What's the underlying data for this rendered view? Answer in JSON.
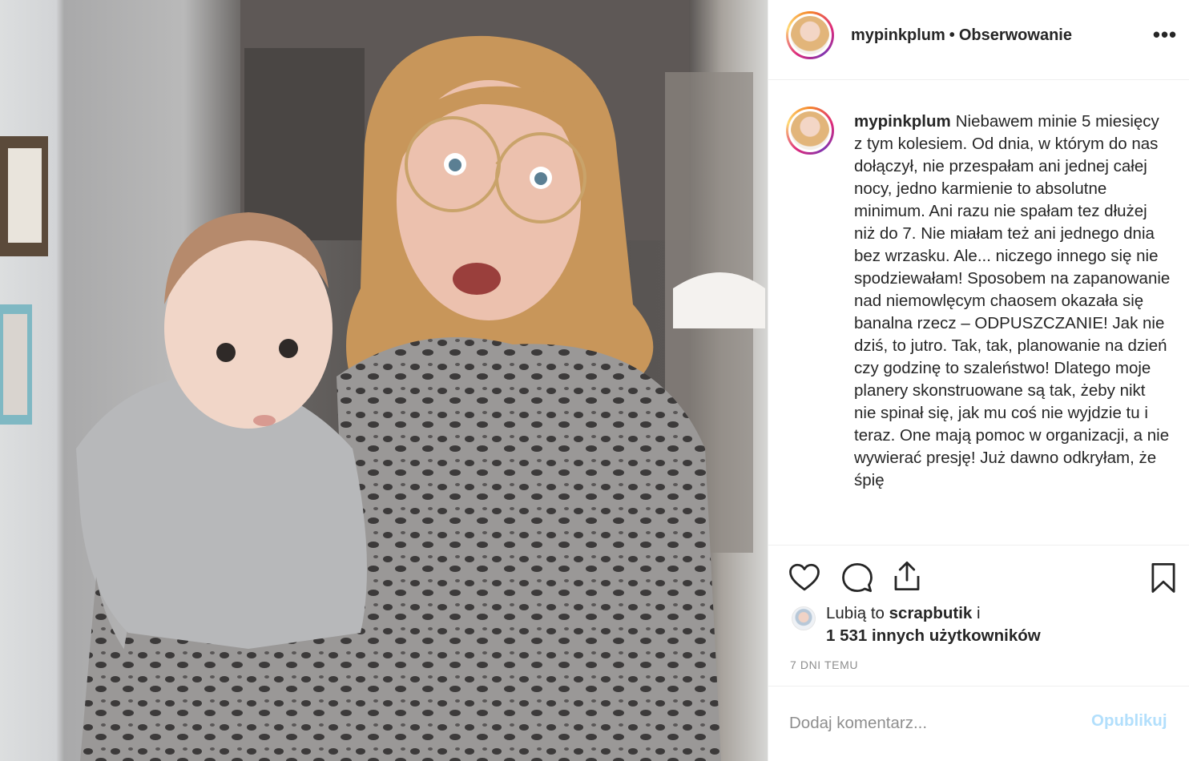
{
  "post": {
    "photo_alt": "Kobieta w okularach trzymająca niemowlę",
    "header": {
      "username": "mypinkplum",
      "separator": "•",
      "follow_status": "Obserwowanie",
      "more_icon": "more-options-icon",
      "more_glyph": "•••"
    },
    "caption": {
      "username": "mypinkplum",
      "text": "Niebawem minie 5 miesięcy z tym kolesiem. Od dnia, w którym do nas dołączył, nie przespałam ani jednej całej nocy, jedno karmienie to absolutne minimum. Ani razu nie spałam tez dłużej niż do 7. Nie miałam też ani jednego dnia bez wrzasku. Ale... niczego innego się nie spodziewałam! Sposobem na zapanowanie nad niemowlęcym chaosem okazała się banalna rzecz – ODPUSZCZANIE! Jak nie dziś, to jutro. Tak, tak, planowanie na dzień czy godzinę to szaleństwo! Dlatego moje planery skonstruowane są tak, żeby nikt nie spinał się, jak mu coś nie wyjdzie tu i teraz. One mają pomoc w organizacji, a nie wywierać presję! Już dawno odkryłam, że śpię"
    },
    "actions": {
      "like_icon": "heart-icon",
      "comment_icon": "comment-icon",
      "share_icon": "share-icon",
      "save_icon": "bookmark-icon"
    },
    "likes": {
      "prefix": "Lubią to",
      "liker": "scrapbutik",
      "conjunction": "i",
      "others": "1 531 innych użytkowników"
    },
    "timestamp": "7 DNI TEMU",
    "comment": {
      "placeholder": "Dodaj komentarz...",
      "value": "",
      "publish_label": "Opublikuj"
    },
    "colors": {
      "text": "#262626",
      "muted": "#8e8e8e",
      "publish_disabled": "#b2dffc",
      "border": "#efefef"
    }
  }
}
